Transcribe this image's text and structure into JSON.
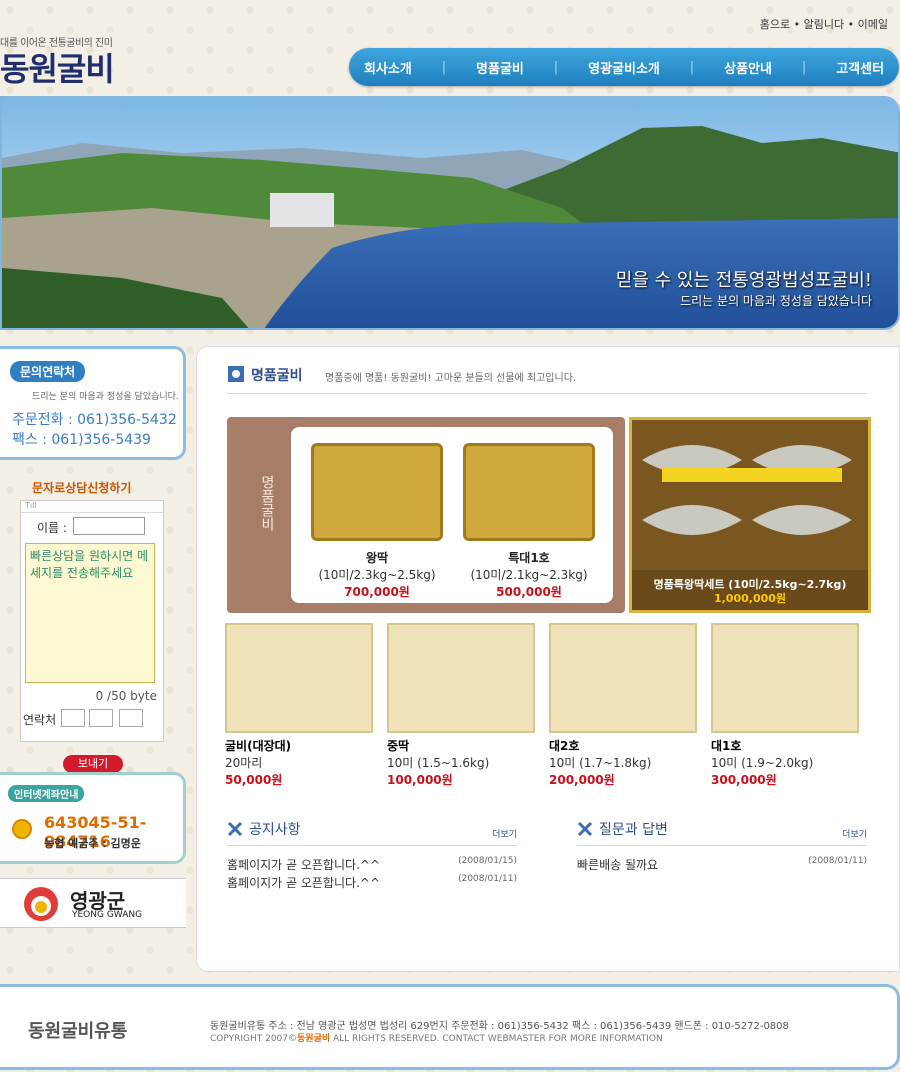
{
  "header": {
    "top_links": [
      "홈으로",
      "알림니다",
      "이메일"
    ],
    "logo_sub": "대를 이어온 전통굴비의 진미",
    "logo": "동원굴비",
    "nav": [
      "회사소개",
      "명품굴비",
      "영광굴비소개",
      "상품안내",
      "고객센터"
    ]
  },
  "banner": {
    "line1": "믿을 수 있는 전통영광법성포굴비!",
    "line2": "드리는 분의 마음과 정성을 담았습니다"
  },
  "contact": {
    "title": "문의연락처",
    "subtitle": "드리는 분의 마음과 정성을 담았습니다.",
    "order": "주문전화 : 061)356-5432",
    "fax": "팩스 : 061)356-5439"
  },
  "sms": {
    "title": "문자로상담신청하기",
    "name_label": "이름 :",
    "message": "빠른상담을 원하시면 메세지를 전송해주세요",
    "byte_count": "0 /50 byte",
    "contact_label": "연락처",
    "send": "보내기"
  },
  "bank": {
    "title": "인터넷계좌안내",
    "account": "643045-51-084716",
    "owner": "농협 예금주 : 김명운"
  },
  "county": {
    "ko": "영광군",
    "en": "YEONG GWANG"
  },
  "section": {
    "title": "명품굴비",
    "desc": "명품중에 명품! 동원굴비! 고마운 분들의 선물에 최고입니다."
  },
  "featured": {
    "vertical": "명품굴비",
    "items": [
      {
        "name": "왕딱",
        "spec": "(10미/2.3kg~2.5kg)",
        "price": "700,000원"
      },
      {
        "name": "특대1호",
        "spec": "(10미/2.1kg~2.3kg)",
        "price": "500,000원"
      }
    ],
    "big": {
      "name": "명품특왕딱세트 (10미/2.5kg~2.7kg)",
      "price": "1,000,000원"
    }
  },
  "products": [
    {
      "name": "굴비(대장대)",
      "spec": "20마리",
      "price": "50,000원"
    },
    {
      "name": "중딱",
      "spec": "10미 (1.5~1.6kg)",
      "price": "100,000원"
    },
    {
      "name": "대2호",
      "spec": "10미 (1.7~1.8kg)",
      "price": "200,000원"
    },
    {
      "name": "대1호",
      "spec": "10미 (1.9~2.0kg)",
      "price": "300,000원"
    }
  ],
  "notice": {
    "title": "공지사항",
    "more": "더보기",
    "rows": [
      {
        "text": "홈페이지가 곧 오픈합니다.^^",
        "date": "(2008/01/15)"
      },
      {
        "text": "홈페이지가 곧 오픈합니다.^^",
        "date": "(2008/01/11)"
      }
    ]
  },
  "qna": {
    "title": "질문과 답변",
    "more": "더보기",
    "rows": [
      {
        "text": "빠른배송 될까요",
        "date": "(2008/01/11)"
      }
    ]
  },
  "footer": {
    "logo": "동원굴비유통",
    "address": "동원굴비유통 주소 : 전남 영광군 법성면 법성리 629번지 주문전화 : 061)356-5432 팩스 : 061)356-5439 핸드폰 : 010-5272-0808",
    "copy_pre": "COPYRIGHT 2007©",
    "copy_brand": "동원굴비",
    "copy_post": " ALL RIGHTS RESERVED. CONTACT WEBMASTER FOR MORE INFORMATION"
  },
  "colors": {
    "nav": "#2b8fd0",
    "accent": "#c8101a",
    "brand": "#1f2f6e"
  }
}
